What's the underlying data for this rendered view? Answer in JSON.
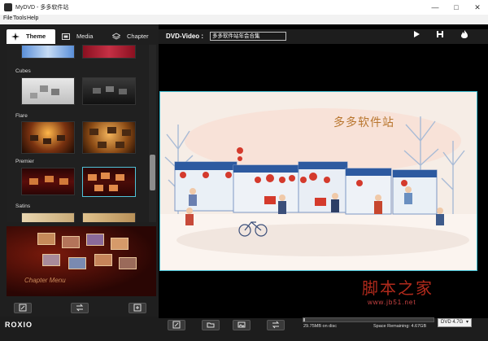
{
  "window": {
    "title": "MyDVD - 多多软件站"
  },
  "menu": {
    "items": [
      "File",
      "Tools",
      "Help"
    ]
  },
  "tabs": [
    {
      "label": "Theme",
      "icon": "theme-icon",
      "active": true
    },
    {
      "label": "Media",
      "icon": "film-icon",
      "active": false
    },
    {
      "label": "Chapter",
      "icon": "layers-icon",
      "active": false
    }
  ],
  "theme_categories": [
    "Cubes",
    "Flare",
    "Premier",
    "Satins"
  ],
  "preview": {
    "caption": "Chapter Menu"
  },
  "project": {
    "type_label": "DVD-Video :",
    "title_value": "多多软件站年会合集"
  },
  "stage": {
    "title": "多多软件站"
  },
  "status": {
    "logo": "ROXIO",
    "used": "29.75MB on disc",
    "remaining": "Space Remaining: 4.67GB",
    "disc_type": "DVD 4.7G",
    "fill_fraction": 0.01
  },
  "watermark": {
    "main": "脚本之家",
    "url": "www.jb51.net"
  },
  "colors": {
    "accent": "#3fbfd3",
    "stage_bg": "#f6ede6",
    "title_gold": "#b9762e"
  }
}
